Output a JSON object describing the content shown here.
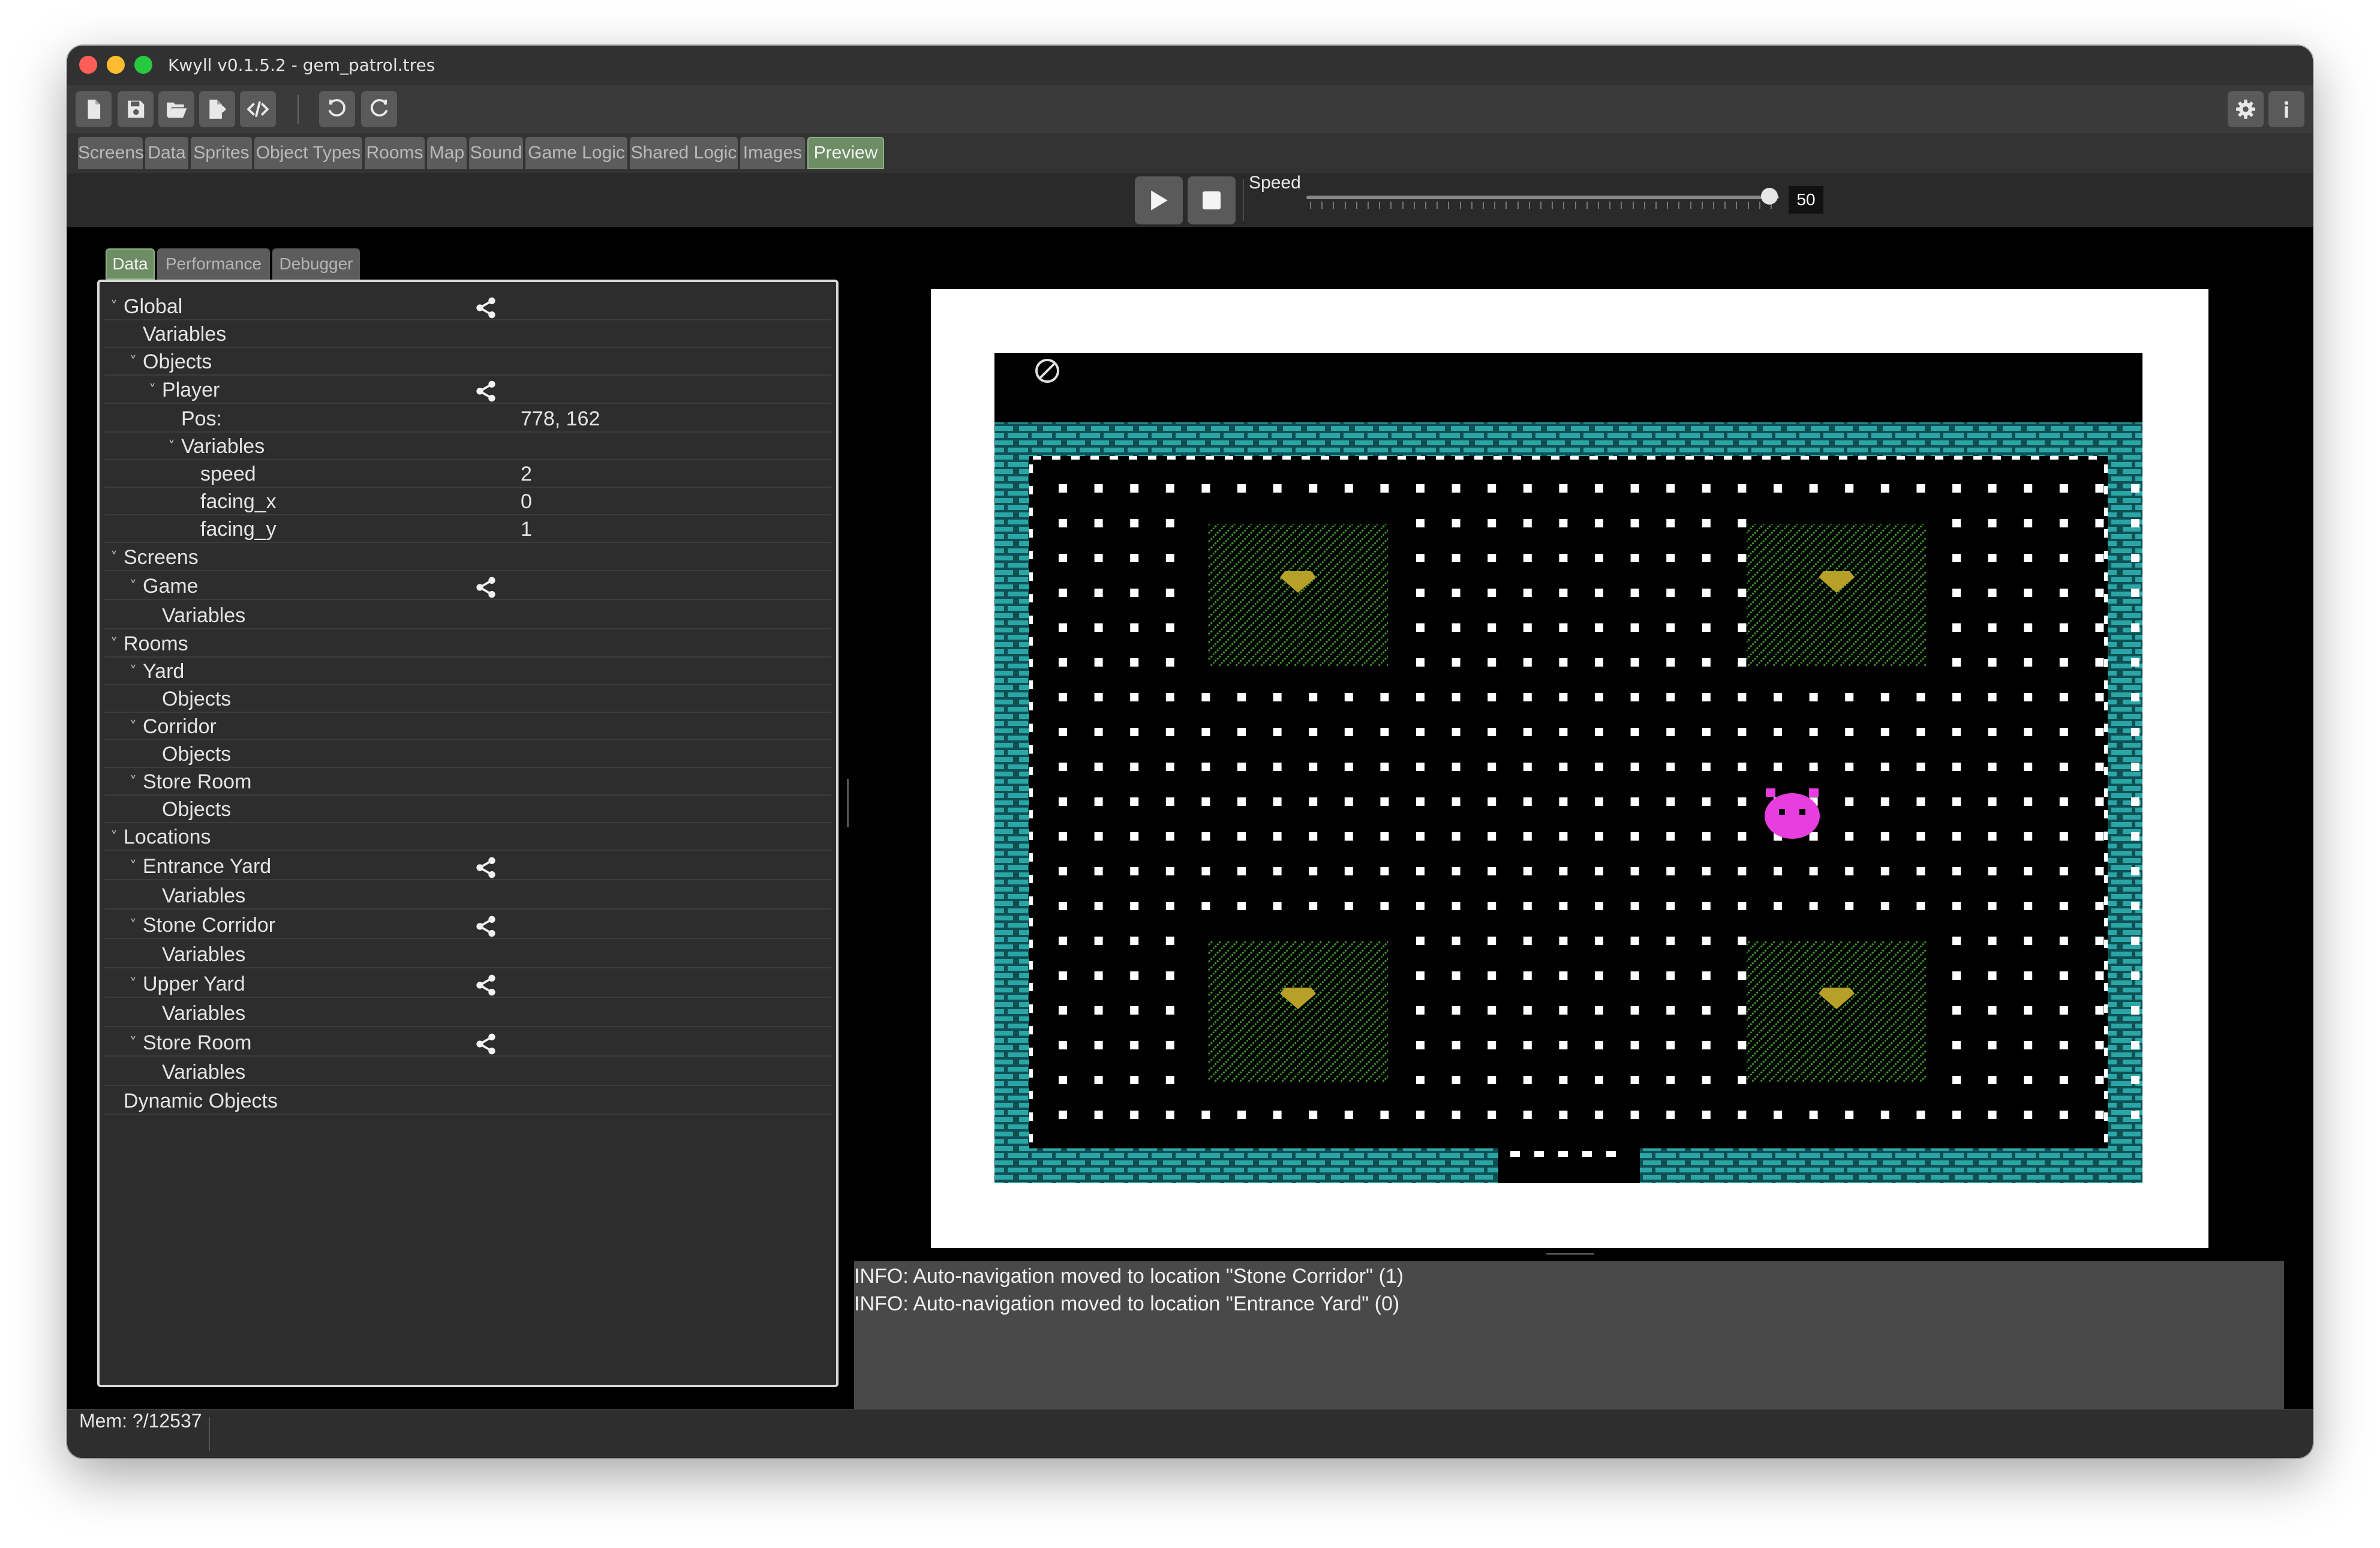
{
  "window": {
    "title": "Kwyll v0.1.5.2 - gem_patrol.tres",
    "traffic_lights": [
      "#ff5f57",
      "#febc2e",
      "#28c840"
    ]
  },
  "toolbar": {
    "left_icons": [
      "new-file-icon",
      "save-icon",
      "open-folder-icon",
      "export-icon",
      "code-icon"
    ],
    "history_icons": [
      "undo-icon",
      "redo-icon"
    ],
    "right_icons": [
      "settings-icon",
      "info-icon"
    ]
  },
  "main_tabs": [
    {
      "label": "Screens",
      "active": false
    },
    {
      "label": "Data",
      "active": false
    },
    {
      "label": "Sprites",
      "active": false
    },
    {
      "label": "Object Types",
      "active": false
    },
    {
      "label": "Rooms",
      "active": false
    },
    {
      "label": "Map",
      "active": false
    },
    {
      "label": "Sound",
      "active": false
    },
    {
      "label": "Game Logic",
      "active": false
    },
    {
      "label": "Shared Logic",
      "active": false
    },
    {
      "label": "Images",
      "active": false
    },
    {
      "label": "Preview",
      "active": true
    }
  ],
  "playbar": {
    "play_icon": "play-icon",
    "stop_icon": "stop-icon",
    "speed_label": "Speed",
    "speed_value": "50",
    "speed_fraction": 0.98
  },
  "left_tabs": [
    {
      "label": "Data",
      "active": true
    },
    {
      "label": "Performance",
      "active": false
    },
    {
      "label": "Debugger",
      "active": false
    }
  ],
  "tree": [
    {
      "label": "Global",
      "depth": 0,
      "expanded": true,
      "share": true
    },
    {
      "label": "Variables",
      "depth": 1
    },
    {
      "label": "Objects",
      "depth": 1,
      "expanded": true
    },
    {
      "label": "Player",
      "depth": 2,
      "expanded": true,
      "share": true
    },
    {
      "label": "Pos:",
      "depth": 3,
      "value": "778, 162"
    },
    {
      "label": "Variables",
      "depth": 3,
      "expanded": true
    },
    {
      "label": "speed",
      "depth": 4,
      "value": "2"
    },
    {
      "label": "facing_x",
      "depth": 4,
      "value": "0"
    },
    {
      "label": "facing_y",
      "depth": 4,
      "value": "1"
    },
    {
      "label": "Screens",
      "depth": 0,
      "expanded": true
    },
    {
      "label": "Game",
      "depth": 1,
      "expanded": true,
      "share": true
    },
    {
      "label": "Variables",
      "depth": 2
    },
    {
      "label": "Rooms",
      "depth": 0,
      "expanded": true
    },
    {
      "label": "Yard",
      "depth": 1,
      "expanded": true
    },
    {
      "label": "Objects",
      "depth": 2
    },
    {
      "label": "Corridor",
      "depth": 1,
      "expanded": true
    },
    {
      "label": "Objects",
      "depth": 2
    },
    {
      "label": "Store Room",
      "depth": 1,
      "expanded": true
    },
    {
      "label": "Objects",
      "depth": 2
    },
    {
      "label": "Locations",
      "depth": 0,
      "expanded": true
    },
    {
      "label": "Entrance Yard",
      "depth": 1,
      "expanded": true,
      "share": true
    },
    {
      "label": "Variables",
      "depth": 2
    },
    {
      "label": "Stone Corridor",
      "depth": 1,
      "expanded": true,
      "share": true
    },
    {
      "label": "Variables",
      "depth": 2
    },
    {
      "label": "Upper Yard",
      "depth": 1,
      "expanded": true,
      "share": true
    },
    {
      "label": "Variables",
      "depth": 2
    },
    {
      "label": "Store Room",
      "depth": 1,
      "expanded": true,
      "share": true
    },
    {
      "label": "Variables",
      "depth": 2
    },
    {
      "label": "Dynamic Objects",
      "depth": 0
    }
  ],
  "game": {
    "hud_icon": "crossed-circle-icon",
    "colors": {
      "wall": "#2aa6a6",
      "wall_mortar": "#0f4f53",
      "dot": "#ffffff",
      "grass": "#3e9a2a",
      "gem": "#b7a028",
      "player": "#e83ee0"
    }
  },
  "console": {
    "lines": [
      "INFO: Auto-navigation moved to location \"Stone Corridor\" (1)",
      "INFO: Auto-navigation moved to location \"Entrance Yard\" (0)"
    ]
  },
  "status": {
    "mem": "Mem: ?/12537"
  }
}
